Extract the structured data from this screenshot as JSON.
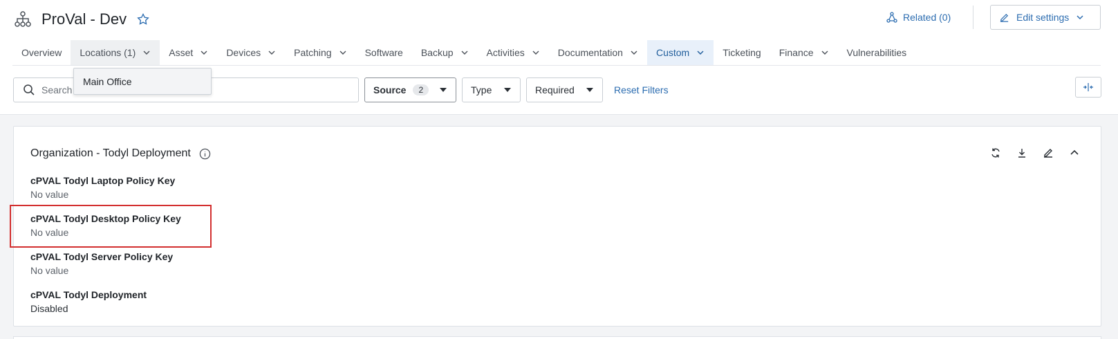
{
  "header": {
    "title": "ProVal - Dev",
    "related_label": "Related (0)",
    "edit_settings_label": "Edit settings"
  },
  "tabs": [
    {
      "label": "Overview"
    },
    {
      "label": "Locations (1)"
    },
    {
      "label": "Asset"
    },
    {
      "label": "Devices"
    },
    {
      "label": "Patching"
    },
    {
      "label": "Software"
    },
    {
      "label": "Backup"
    },
    {
      "label": "Activities"
    },
    {
      "label": "Documentation"
    },
    {
      "label": "Custom"
    },
    {
      "label": "Ticketing"
    },
    {
      "label": "Finance"
    },
    {
      "label": "Vulnerabilities"
    }
  ],
  "locations_dropdown": {
    "items": [
      "Main Office"
    ]
  },
  "filters": {
    "search_placeholder": "Search",
    "source_label": "Source",
    "source_count": "2",
    "type_label": "Type",
    "required_label": "Required",
    "reset_label": "Reset Filters"
  },
  "panel": {
    "title": "Organization - Todyl Deployment",
    "fields": [
      {
        "label": "cPVAL Todyl Laptop Policy Key",
        "value": "No value"
      },
      {
        "label": "cPVAL Todyl Desktop Policy Key",
        "value": "No value"
      },
      {
        "label": "cPVAL Todyl Server Policy Key",
        "value": "No value"
      },
      {
        "label": "cPVAL Todyl Deployment",
        "value": "Disabled"
      }
    ]
  },
  "colors": {
    "accent": "#2b6cb0",
    "active_tab_bg": "#e8f0fa",
    "highlight_border": "#d32f2f"
  },
  "icons": {
    "org": "org-chart-icon",
    "favorite": "star-outline-icon",
    "related": "network-icon",
    "edit": "edit-icon",
    "search": "search-icon",
    "collapse_columns": "collapse-columns-icon",
    "info": "info-icon",
    "refresh": "refresh-icon",
    "download": "download-icon",
    "edit_panel": "edit-icon",
    "collapse_panel": "chevron-up-icon"
  }
}
